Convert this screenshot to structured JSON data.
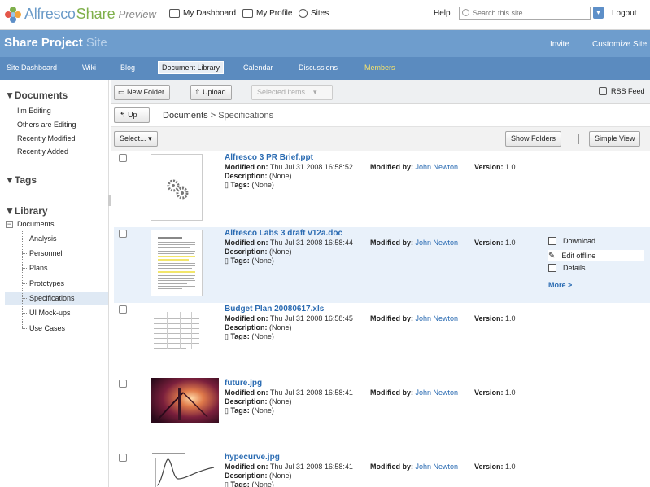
{
  "header": {
    "brand": "Alfresco",
    "brand_share": "Share",
    "brand_preview": "Preview",
    "nav": [
      {
        "label": "My Dashboard",
        "icon": "dashboard-icon"
      },
      {
        "label": "My Profile",
        "icon": "profile-icon"
      },
      {
        "label": "Sites",
        "icon": "sites-icon"
      }
    ],
    "help": "Help",
    "search_placeholder": "Search this site",
    "logout": "Logout"
  },
  "site": {
    "title": "Share Project",
    "title_suffix": "Site",
    "invite": "Invite",
    "customize": "Customize Site",
    "nav": [
      "Site Dashboard",
      "Wiki",
      "Blog",
      "Document Library",
      "Calendar",
      "Discussions",
      "Members"
    ],
    "active_nav": "Document Library"
  },
  "sidebar": {
    "documents_heading": "Documents",
    "filters": [
      "I'm Editing",
      "Others are Editing",
      "Recently Modified",
      "Recently Added"
    ],
    "tags_heading": "Tags",
    "library_heading": "Library",
    "tree_root": "Documents",
    "tree_children": [
      "Analysis",
      "Personnel",
      "Plans",
      "Prototypes",
      "Specifications",
      "UI Mock-ups",
      "Use Cases"
    ],
    "selected_folder": "Specifications"
  },
  "toolbar": {
    "new_folder": "New Folder",
    "upload": "Upload",
    "selected_items": "Selected items...",
    "rss": "RSS Feed",
    "up": "Up",
    "breadcrumb_root": "Documents",
    "breadcrumb_sep": ">",
    "breadcrumb_current": "Specifications",
    "select": "Select...",
    "show_folders": "Show Folders",
    "simple_view": "Simple View"
  },
  "labels": {
    "modified_on": "Modified on:",
    "description": "Description:",
    "tags": "Tags:",
    "modified_by": "Modified by:",
    "version": "Version:"
  },
  "documents": [
    {
      "name": "Alfresco 3 PR Brief.ppt",
      "modified_on": "Thu Jul 31 2008 16:58:52",
      "description": "(None)",
      "tags": "(None)",
      "modified_by": "John Newton",
      "version": "1.0"
    },
    {
      "name": "Alfresco Labs 3 draft v12a.doc",
      "modified_on": "Thu Jul 31 2008 16:58:44",
      "description": "(None)",
      "tags": "(None)",
      "modified_by": "John Newton",
      "version": "1.0"
    },
    {
      "name": "Budget Plan 20080617.xls",
      "modified_on": "Thu Jul 31 2008 16:58:45",
      "description": "(None)",
      "tags": "(None)",
      "modified_by": "John Newton",
      "version": "1.0"
    },
    {
      "name": "future.jpg",
      "modified_on": "Thu Jul 31 2008 16:58:41",
      "description": "(None)",
      "tags": "(None)",
      "modified_by": "John Newton",
      "version": "1.0"
    },
    {
      "name": "hypecurve.jpg",
      "modified_on": "Thu Jul 31 2008 16:58:41",
      "description": "(None)",
      "tags": "(None)",
      "modified_by": "John Newton",
      "version": "1.0"
    }
  ],
  "row_actions": {
    "download": "Download",
    "edit_offline": "Edit offline",
    "details": "Details",
    "more": "More >"
  },
  "colors": {
    "site_bar": "#6e9dcd",
    "site_nav": "#5b8bbf",
    "link": "#2a6bb2",
    "members": "#f7e36b"
  }
}
